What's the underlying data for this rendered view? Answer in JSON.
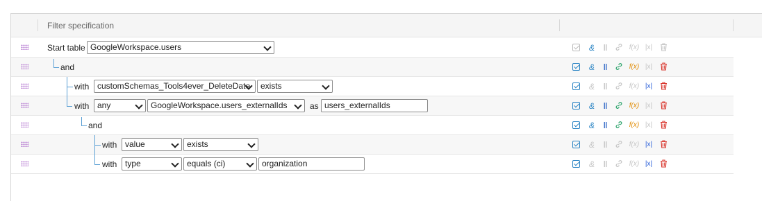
{
  "header": {
    "title": "Filter specification"
  },
  "rows": [
    {
      "start_label": "Start table",
      "table": "GoogleWorkspace.users"
    },
    {
      "and": "and"
    },
    {
      "with": "with",
      "field": "customSchemas_Tools4ever_DeleteDate",
      "op": "exists"
    },
    {
      "with": "with",
      "quant": "any",
      "table": "GoogleWorkspace.users_externalIds",
      "as": "as",
      "alias": "users_externalIds"
    },
    {
      "and": "and"
    },
    {
      "with": "with",
      "field": "value",
      "op": "exists"
    },
    {
      "with": "with",
      "field": "type",
      "op": "equals (ci)",
      "value": "organization"
    }
  ],
  "icons": {
    "checkbox": "checkbox-icon",
    "and": "and-icon",
    "or": "or-icon",
    "link": "link-icon",
    "function": "function-icon",
    "abs": "abs-icon",
    "delete": "trash-icon"
  },
  "colors": {
    "accent": "#2a84c4",
    "link": "#2aa36a",
    "function": "#e08a00",
    "delete": "#d9342b",
    "grip": "#b57ad0"
  },
  "action_glyphs": {
    "and": "&",
    "or": "‖",
    "function": "f(x)",
    "abs": "|x|"
  }
}
